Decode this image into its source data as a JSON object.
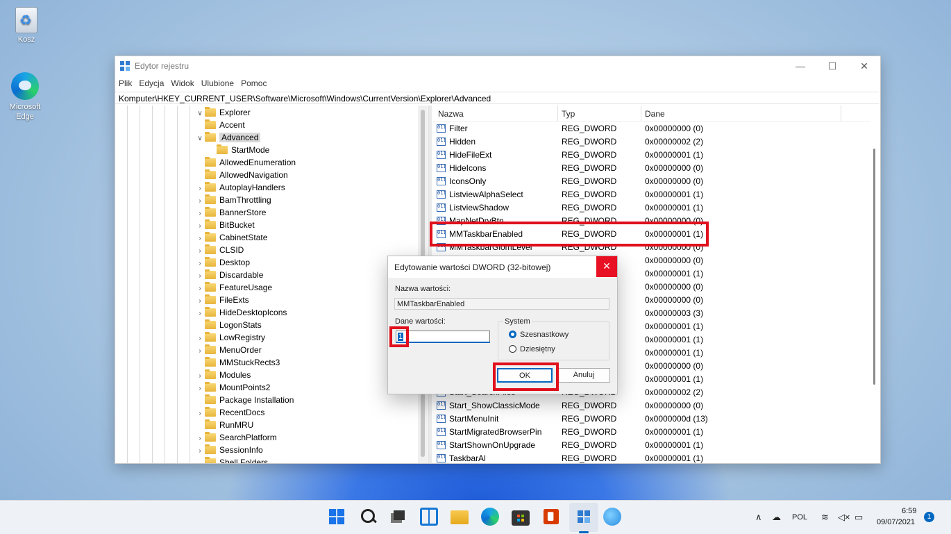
{
  "desktop": {
    "icons": [
      {
        "label": "Kosz",
        "icon": "recycle-bin-icon"
      },
      {
        "label": "Microsoft Edge",
        "icon": "edge-icon"
      }
    ]
  },
  "window": {
    "title": "Edytor rejestru",
    "controls": {
      "minimize": "—",
      "maximize": "☐",
      "close": "✕"
    },
    "menu": [
      "Plik",
      "Edycja",
      "Widok",
      "Ulubione",
      "Pomoc"
    ],
    "address": "Komputer\\HKEY_CURRENT_USER\\Software\\Microsoft\\Windows\\CurrentVersion\\Explorer\\Advanced"
  },
  "tree": {
    "items": [
      {
        "label": "Explorer",
        "arrow": "∨"
      },
      {
        "label": "Accent",
        "arrow": ""
      },
      {
        "label": "Advanced",
        "arrow": "∨",
        "selected": true
      },
      {
        "label": "StartMode",
        "arrow": ""
      },
      {
        "label": "AllowedEnumeration",
        "arrow": ""
      },
      {
        "label": "AllowedNavigation",
        "arrow": ""
      },
      {
        "label": "AutoplayHandlers",
        "arrow": "›"
      },
      {
        "label": "BamThrottling",
        "arrow": "›"
      },
      {
        "label": "BannerStore",
        "arrow": "›"
      },
      {
        "label": "BitBucket",
        "arrow": "›"
      },
      {
        "label": "CabinetState",
        "arrow": "›"
      },
      {
        "label": "CLSID",
        "arrow": "›"
      },
      {
        "label": "Desktop",
        "arrow": "›"
      },
      {
        "label": "Discardable",
        "arrow": "›"
      },
      {
        "label": "FeatureUsage",
        "arrow": "›"
      },
      {
        "label": "FileExts",
        "arrow": "›"
      },
      {
        "label": "HideDesktopIcons",
        "arrow": "›"
      },
      {
        "label": "LogonStats",
        "arrow": ""
      },
      {
        "label": "LowRegistry",
        "arrow": "›"
      },
      {
        "label": "MenuOrder",
        "arrow": "›"
      },
      {
        "label": "MMStuckRects3",
        "arrow": ""
      },
      {
        "label": "Modules",
        "arrow": "›"
      },
      {
        "label": "MountPoints2",
        "arrow": "›"
      },
      {
        "label": "Package Installation",
        "arrow": ""
      },
      {
        "label": "RecentDocs",
        "arrow": "›"
      },
      {
        "label": "RunMRU",
        "arrow": ""
      },
      {
        "label": "SearchPlatform",
        "arrow": "›"
      },
      {
        "label": "SessionInfo",
        "arrow": "›"
      },
      {
        "label": "Shell Folders",
        "arrow": ""
      }
    ]
  },
  "list": {
    "headers": [
      "Nazwa",
      "Typ",
      "Dane"
    ],
    "rows": [
      {
        "name": "Filter",
        "type": "REG_DWORD",
        "data": "0x00000000 (0)"
      },
      {
        "name": "Hidden",
        "type": "REG_DWORD",
        "data": "0x00000002 (2)"
      },
      {
        "name": "HideFileExt",
        "type": "REG_DWORD",
        "data": "0x00000001 (1)"
      },
      {
        "name": "HideIcons",
        "type": "REG_DWORD",
        "data": "0x00000000 (0)"
      },
      {
        "name": "IconsOnly",
        "type": "REG_DWORD",
        "data": "0x00000000 (0)"
      },
      {
        "name": "ListviewAlphaSelect",
        "type": "REG_DWORD",
        "data": "0x00000001 (1)"
      },
      {
        "name": "ListviewShadow",
        "type": "REG_DWORD",
        "data": "0x00000001 (1)"
      },
      {
        "name": "MapNetDrvBtn",
        "type": "REG_DWORD",
        "data": "0x00000000 (0)"
      },
      {
        "name": "MMTaskbarEnabled",
        "type": "REG_DWORD",
        "data": "0x00000001 (1)"
      },
      {
        "name": "MMTaskbarGlomLevel",
        "type": "REG_DWORD",
        "data": "0x00000000 (0)"
      },
      {
        "name": "",
        "type": "",
        "data": "0x00000000 (0)"
      },
      {
        "name": "",
        "type": "",
        "data": "0x00000001 (1)"
      },
      {
        "name": "",
        "type": "",
        "data": "0x00000000 (0)"
      },
      {
        "name": "",
        "type": "",
        "data": "0x00000000 (0)"
      },
      {
        "name": "",
        "type": "",
        "data": "0x00000003 (3)"
      },
      {
        "name": "",
        "type": "",
        "data": "0x00000001 (1)"
      },
      {
        "name": "",
        "type": "",
        "data": "0x00000001 (1)"
      },
      {
        "name": "",
        "type": "",
        "data": "0x00000001 (1)"
      },
      {
        "name": "",
        "type": "",
        "data": "0x00000000 (0)"
      },
      {
        "name": "",
        "type": "",
        "data": "0x00000001 (1)"
      },
      {
        "name": "Start_SearchFiles",
        "type": "REG_DWORD",
        "data": "0x00000002 (2)"
      },
      {
        "name": "Start_ShowClassicMode",
        "type": "REG_DWORD",
        "data": "0x00000000 (0)"
      },
      {
        "name": "StartMenuInit",
        "type": "REG_DWORD",
        "data": "0x0000000d (13)"
      },
      {
        "name": "StartMigratedBrowserPin",
        "type": "REG_DWORD",
        "data": "0x00000001 (1)"
      },
      {
        "name": "StartShownOnUpgrade",
        "type": "REG_DWORD",
        "data": "0x00000001 (1)"
      },
      {
        "name": "TaskbarAl",
        "type": "REG_DWORD",
        "data": "0x00000001 (1)"
      }
    ]
  },
  "dialog": {
    "title": "Edytowanie wartości DWORD (32-bitowej)",
    "close": "✕",
    "name_label": "Nazwa wartości:",
    "name_value": "MMTaskbarEnabled",
    "data_label": "Dane wartości:",
    "data_value": "1",
    "system_label": "System",
    "radio_hex": "Szesnastkowy",
    "radio_dec": "Dziesiętny",
    "ok": "OK",
    "cancel": "Anuluj"
  },
  "taskbar": {
    "apps": [
      "start-icon",
      "search-icon",
      "task-view-icon",
      "widgets-icon",
      "file-explorer-icon",
      "edge-icon",
      "store-icon",
      "office-icon",
      "regedit-icon",
      "control-panel-icon"
    ],
    "tray": {
      "chevron": "∧",
      "lang": "POL",
      "time": "6:59",
      "date": "09/07/2021",
      "notifications": "1"
    }
  },
  "colors": {
    "highlight": "#e0101d",
    "accent": "#0067c0",
    "dialog_close": "#e81123"
  }
}
